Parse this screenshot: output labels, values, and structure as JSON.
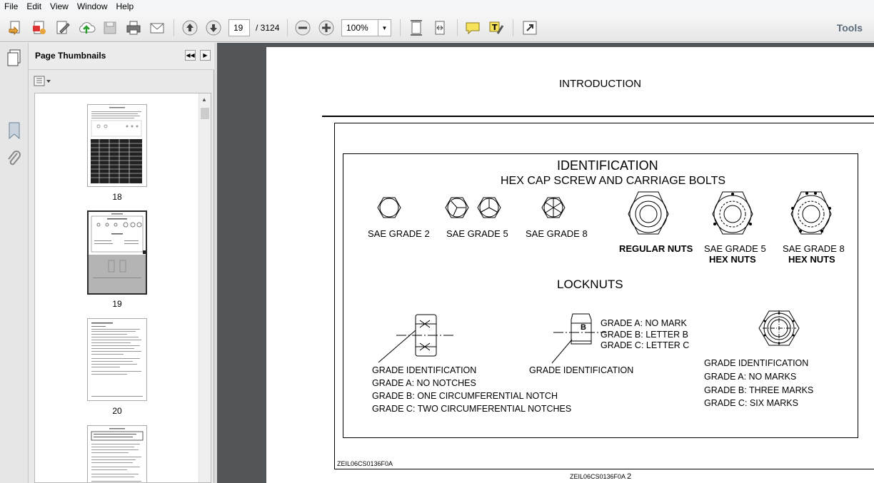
{
  "menu": [
    "File",
    "Edit",
    "View",
    "Window",
    "Help"
  ],
  "toolbar": {
    "current_page": "19",
    "total_pages": "/ 3124",
    "zoom": "100%",
    "tools_label": "Tools"
  },
  "sidebar": {
    "panel_title": "Page Thumbnails",
    "thumbnails": [
      {
        "label": "18"
      },
      {
        "label": "19"
      },
      {
        "label": "20"
      }
    ]
  },
  "document": {
    "header": "INTRODUCTION",
    "figure": {
      "title": "IDENTIFICATION",
      "subtitle": "HEX CAP SCREW AND CARRIAGE BOLTS",
      "sae_grade_2": "SAE GRADE 2",
      "sae_grade_5": "SAE GRADE 5",
      "sae_grade_8": "SAE GRADE 8",
      "regular_nuts": "REGULAR NUTS",
      "sae_grade_5_nut": "SAE GRADE 5",
      "hex_nuts_5": "HEX NUTS",
      "sae_grade_8_nut": "SAE GRADE 8",
      "hex_nuts_8": "HEX NUTS",
      "locknuts": "LOCKNUTS",
      "left_grade_id": "GRADE IDENTIFICATION",
      "left_a": "GRADE A: NO NOTCHES",
      "left_b": "GRADE B: ONE CIRCUMFERENTIAL NOTCH",
      "left_c": "GRADE C: TWO CIRCUMFERENTIAL NOTCHES",
      "mid_a": "GRADE A: NO MARK",
      "mid_b": "GRADE B: LETTER B",
      "mid_c": "GRADE C: LETTER C",
      "mid_letter": "B",
      "mid_grade_id": "GRADE IDENTIFICATION",
      "right_grade_id": "GRADE IDENTIFICATION",
      "right_a": "GRADE A: NO MARKS",
      "right_b": "GRADE B: THREE MARKS",
      "right_c": "GRADE C: SIX MARKS",
      "figure_code": "ZEIL06CS0136F0A"
    },
    "footer_code": "ZEIL06CS0136F0A",
    "footer_page": "2"
  }
}
